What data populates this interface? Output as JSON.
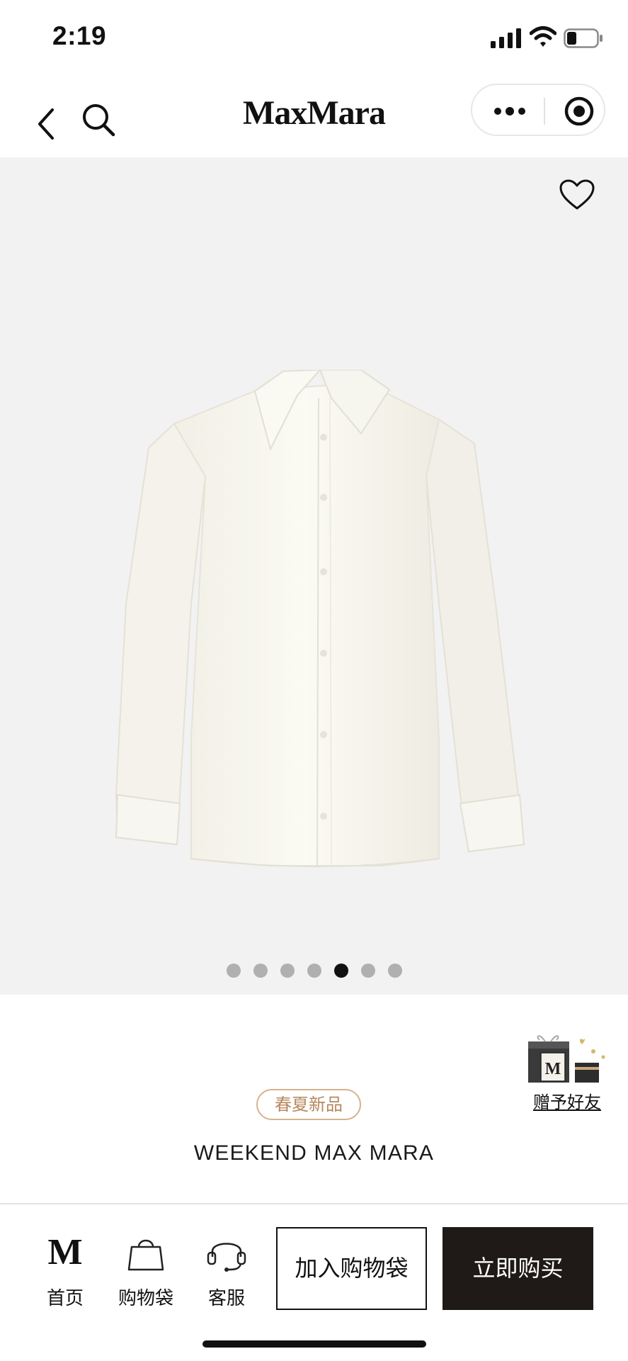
{
  "status_bar": {
    "time": "2:19",
    "icons": [
      "signal-icon",
      "wifi-icon",
      "battery-icon"
    ]
  },
  "header": {
    "brand": "MaxMara",
    "icons": [
      "back-icon",
      "search-icon",
      "more-icon",
      "target-icon"
    ]
  },
  "gallery": {
    "image_count": 7,
    "active_index": 4,
    "favorite_icon": "heart-icon"
  },
  "gift": {
    "label": "赠予好友",
    "icon": "gift-box-icon"
  },
  "product": {
    "badge": "春夏新品",
    "brand": "WEEKEND MAX MARA"
  },
  "bottom_bar": {
    "tabs": [
      {
        "label": "首页",
        "icon": "m-logo-icon",
        "glyph": "M"
      },
      {
        "label": "购物袋",
        "icon": "shopping-bag-icon"
      },
      {
        "label": "客服",
        "icon": "headset-icon"
      }
    ],
    "add_to_bag": "加入购物袋",
    "buy_now": "立即购买"
  },
  "colors": {
    "accent": "#1f1a18",
    "badge": "#b8875e",
    "gallery_bg": "#f2f2f2"
  }
}
